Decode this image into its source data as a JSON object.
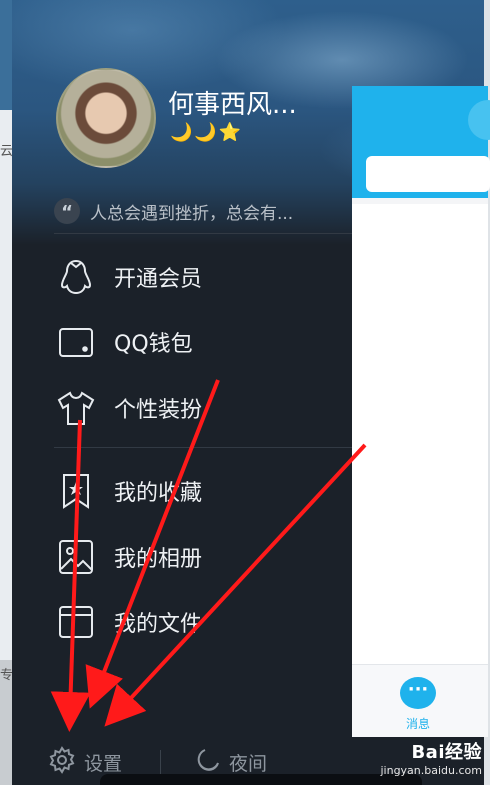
{
  "edge": {
    "left_fragment_1": "云",
    "left_fragment_2": "专"
  },
  "profile": {
    "name": "何事西风...",
    "levels": "🌙🌙⭐",
    "signature": "人总会遇到挫折，总会有..."
  },
  "menu": {
    "items": [
      {
        "label": "开通会员",
        "icon": "penguin-icon"
      },
      {
        "label": "QQ钱包",
        "icon": "wallet-icon"
      },
      {
        "label": "个性装扮",
        "icon": "tshirt-icon"
      },
      {
        "label": "我的收藏",
        "icon": "bookmark-star-icon"
      },
      {
        "label": "我的相册",
        "icon": "photo-album-icon"
      },
      {
        "label": "我的文件",
        "icon": "folder-icon"
      }
    ]
  },
  "bottom": {
    "settings_label": "设置",
    "night_label": "夜间"
  },
  "panel": {
    "tab_label": "消息"
  },
  "watermark": {
    "logo": "Bai经验",
    "url": "jingyan.baidu.com"
  },
  "colors": {
    "drawer_bg": "#1b2129",
    "accent_blue": "#1fb2ec",
    "arrow_red": "#ff1a1a"
  }
}
